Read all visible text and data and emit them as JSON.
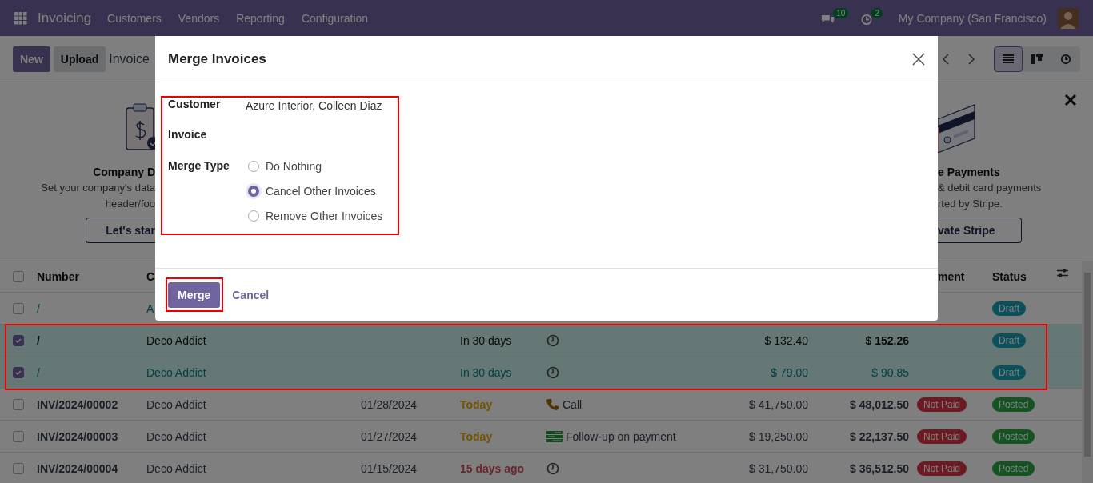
{
  "navbar": {
    "app_name": "Invoicing",
    "menu": [
      "Customers",
      "Vendors",
      "Reporting",
      "Configuration"
    ],
    "messages_count": "10",
    "activities_count": "2",
    "company": "My Company (San Francisco)"
  },
  "control_panel": {
    "buttons": [
      {
        "label": "New",
        "kind": "primary"
      },
      {
        "label": "Upload",
        "kind": "secondary"
      }
    ],
    "breadcrumb": "Invoice",
    "views": [
      {
        "kind": "list",
        "selected": true
      },
      {
        "kind": "kanban",
        "selected": false
      },
      {
        "kind": "activity",
        "selected": false
      }
    ]
  },
  "banner": {
    "left": {
      "title": "Company D",
      "text_lines": [
        "Set your company's data",
        "header/foo"
      ],
      "button": "Let's star"
    },
    "right": {
      "title": "e Payments",
      "text_lines": [
        "& debit card payments",
        "rted by Stripe."
      ],
      "button": "vate Stripe"
    }
  },
  "table": {
    "select_all_checked": false,
    "columns": [
      "Number",
      "C",
      "ment",
      "Status"
    ],
    "rows": [
      {
        "checked": false,
        "kind": "link",
        "number": "/",
        "customer": "A",
        "status": {
          "label": "Draft",
          "kind": "draft"
        }
      },
      {
        "checked": true,
        "kind": "default",
        "number": "/",
        "customer": "Deco Addict",
        "due": {
          "text": "In 30 days",
          "kind": "default"
        },
        "activity": {
          "kind": "clock"
        },
        "untaxed": "$ 132.40",
        "total": "$ 152.26",
        "status": {
          "label": "Draft",
          "kind": "draft"
        }
      },
      {
        "checked": true,
        "kind": "link",
        "number": "/",
        "customer": "Deco Addict",
        "due": {
          "text": "In 30 days",
          "kind": "default"
        },
        "activity": {
          "kind": "clock"
        },
        "untaxed": "$ 79.00",
        "total": "$ 90.85",
        "status": {
          "label": "Draft",
          "kind": "draft"
        }
      },
      {
        "checked": false,
        "kind": "default",
        "number": "INV/2024/00002",
        "customer": "Deco Addict",
        "date": "01/28/2024",
        "due": {
          "text": "Today",
          "kind": "warning"
        },
        "activity": {
          "kind": "call",
          "label": "Call"
        },
        "untaxed": "$ 41,750.00",
        "total": "$ 48,012.50",
        "payment": {
          "label": "Not Paid",
          "kind": "not_paid"
        },
        "status": {
          "label": "Posted",
          "kind": "posted"
        }
      },
      {
        "checked": false,
        "kind": "default",
        "number": "INV/2024/00003",
        "customer": "Deco Addict",
        "date": "01/27/2024",
        "due": {
          "text": "Today",
          "kind": "warning"
        },
        "activity": {
          "kind": "followup",
          "label": "Follow-up on payment"
        },
        "untaxed": "$ 19,250.00",
        "total": "$ 22,137.50",
        "payment": {
          "label": "Not Paid",
          "kind": "not_paid"
        },
        "status": {
          "label": "Posted",
          "kind": "posted"
        }
      },
      {
        "checked": false,
        "kind": "default",
        "number": "INV/2024/00004",
        "customer": "Deco Addict",
        "date": "01/15/2024",
        "due": {
          "text": "15 days ago",
          "kind": "danger"
        },
        "activity": {
          "kind": "clock"
        },
        "untaxed": "$ 31,750.00",
        "total": "$ 36,512.50",
        "payment": {
          "label": "Not Paid",
          "kind": "not_paid"
        },
        "status": {
          "label": "Posted",
          "kind": "posted"
        }
      }
    ]
  },
  "dialog": {
    "title": "Merge Invoices",
    "fields": [
      {
        "label": "Customer",
        "value": "Azure Interior, Colleen Diaz"
      },
      {
        "label": "Invoice"
      }
    ],
    "merge_type": {
      "label": "Merge Type",
      "options": [
        {
          "label": "Do Nothing",
          "selected": false
        },
        {
          "label": "Cancel Other Invoices",
          "selected": true
        },
        {
          "label": "Remove Other Invoices",
          "selected": false
        }
      ]
    },
    "buttons": [
      {
        "label": "Merge",
        "kind": "primary"
      },
      {
        "label": "Cancel",
        "kind": "link"
      }
    ]
  }
}
